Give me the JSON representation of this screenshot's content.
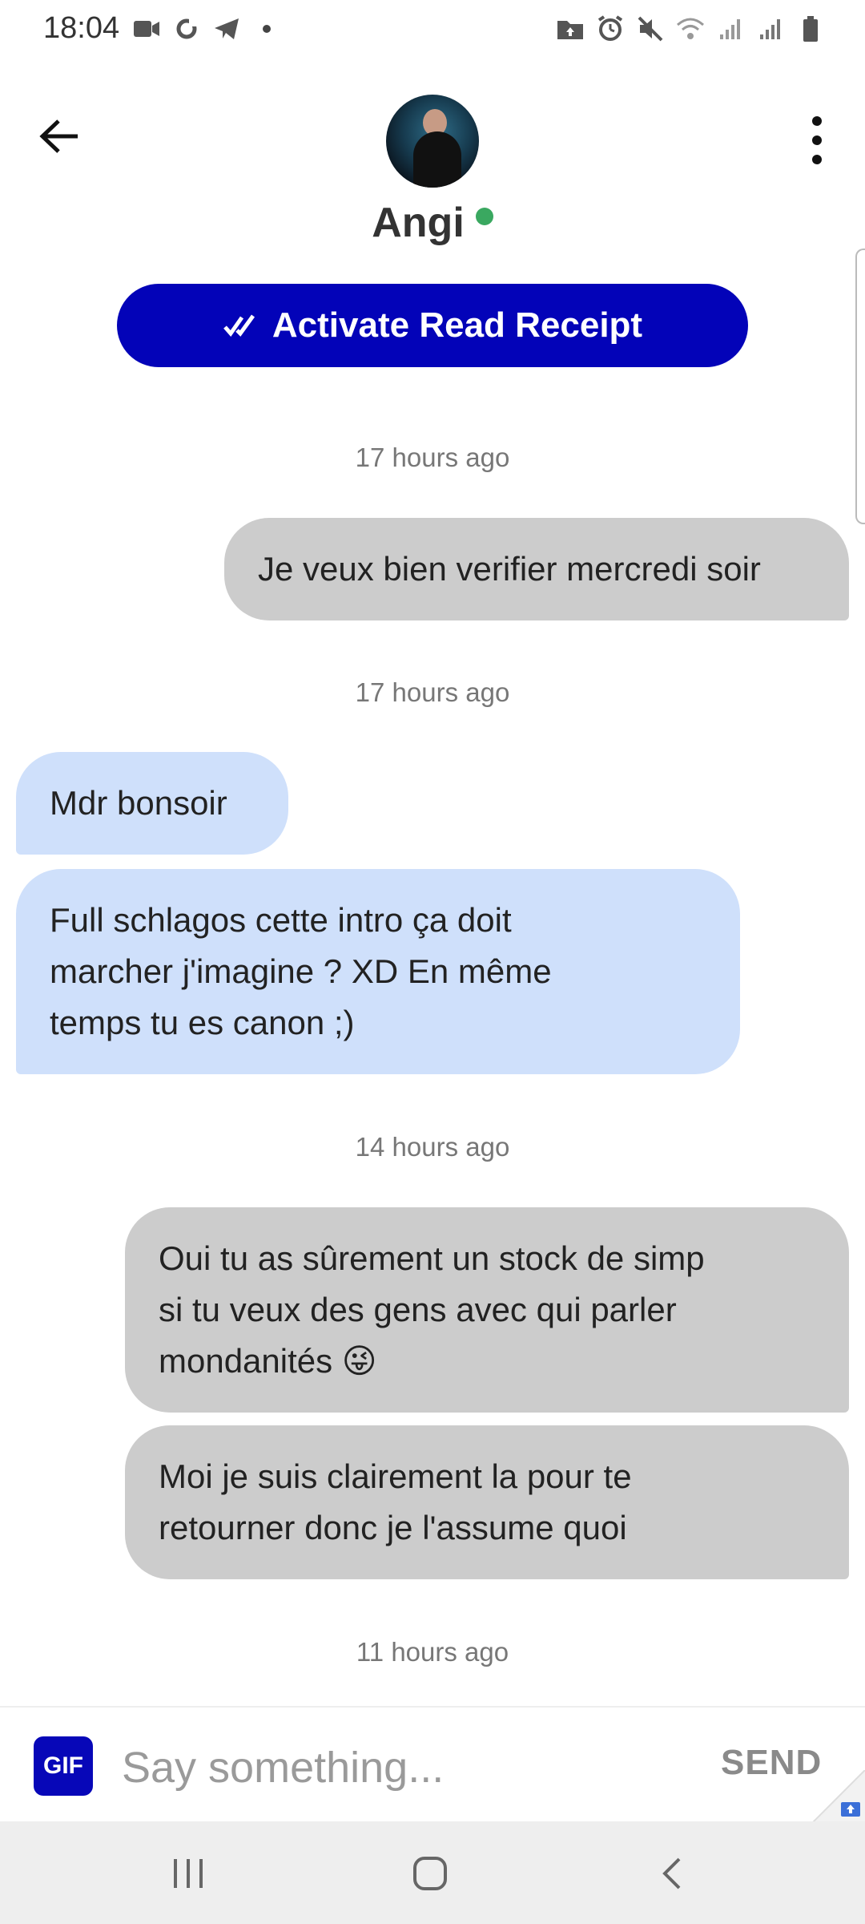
{
  "status_bar": {
    "time": "18:04",
    "left_icons": [
      "video-icon",
      "sync-icon",
      "telegram-icon"
    ],
    "right_icons": [
      "folder-icon",
      "alarm-icon",
      "mute-icon",
      "wifi-icon",
      "signal-icon",
      "signal-roaming-icon",
      "battery-icon"
    ]
  },
  "header": {
    "contact_name": "Angi",
    "online": true,
    "read_receipt_label": "Activate Read Receipt"
  },
  "messages": [
    {
      "type": "timestamp",
      "text": "17 hours ago"
    },
    {
      "type": "sent",
      "text": "Je veux bien verifier mercredi soir"
    },
    {
      "type": "timestamp",
      "text": "17 hours ago"
    },
    {
      "type": "received",
      "text": "Mdr bonsoir"
    },
    {
      "type": "received",
      "lines": [
        "Full schlagos cette intro ça doit",
        "marcher j'imagine ? XD En même",
        "temps tu es canon ;)"
      ]
    },
    {
      "type": "timestamp",
      "text": "14 hours ago"
    },
    {
      "type": "sent",
      "lines": [
        "Oui tu as sûrement un stock de simp",
        "si tu veux des gens avec qui parler",
        "mondanités 😜"
      ]
    },
    {
      "type": "sent",
      "lines": [
        "Moi je suis clairement la pour te",
        "retourner donc je l'assume quoi"
      ]
    },
    {
      "type": "timestamp",
      "text": "11 hours ago"
    }
  ],
  "composer": {
    "gif_label": "GIF",
    "placeholder": "Say something...",
    "send_label": "SEND"
  },
  "colors": {
    "accent": "#0303b8",
    "sent_bubble": "#cccccc",
    "received_bubble": "#cfe0fb",
    "online": "#3aa860"
  }
}
